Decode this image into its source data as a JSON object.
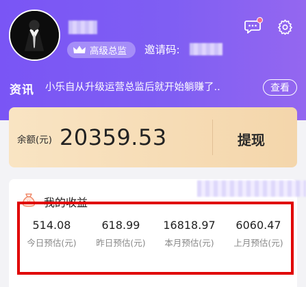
{
  "header": {
    "badge_label": "高级总监",
    "invite_label": "邀请码:",
    "news_tag": "资讯",
    "news_text": "小乐自从升级运营总监后就开始躺赚了..",
    "view_label": "查看"
  },
  "balance": {
    "label": "余额(元)",
    "value": "20359.53",
    "withdraw_label": "提现"
  },
  "income": {
    "title": "我的收益",
    "stats": [
      {
        "value": "514.08",
        "label": "今日预估(元)"
      },
      {
        "value": "618.99",
        "label": "昨日预估(元)"
      },
      {
        "value": "16818.97",
        "label": "本月预估(元)"
      },
      {
        "value": "6060.47",
        "label": "上月预估(元)"
      }
    ]
  },
  "colors": {
    "header_start": "#7a55f5",
    "header_end": "#9467f0",
    "card_gold": "#f4d6ab",
    "highlight_red": "#e00000",
    "notification_dot": "#f36d8e"
  },
  "icons": [
    "avatar-suit-icon",
    "crown-icon",
    "message-icon",
    "gear-icon",
    "money-bag-icon"
  ]
}
